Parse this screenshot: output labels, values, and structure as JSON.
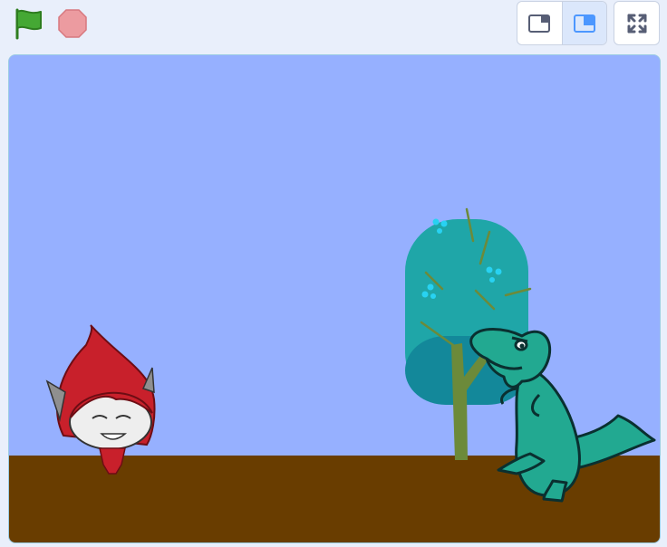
{
  "toolbar": {
    "green_flag_icon": "green-flag-icon",
    "stop_icon": "stop-sign-icon",
    "small_stage_icon": "small-stage-layout-icon",
    "large_stage_icon": "large-stage-layout-icon",
    "fullscreen_icon": "fullscreen-icon",
    "active_mode": "large-stage"
  },
  "stage": {
    "backdrop": {
      "sky_color": "#96b0ff",
      "ground_color": "#693d00"
    },
    "sprites": [
      {
        "name_icon": "red-hair-character-icon",
        "color": "#c8202b"
      },
      {
        "name_icon": "teal-tree-icon",
        "color": "#1fa6a8"
      },
      {
        "name_icon": "green-dinosaur-icon",
        "color": "#22a991"
      }
    ]
  },
  "colors": {
    "accent": "#4c97ff",
    "flag_green": "#45a834",
    "stop_red": "#ec9ba0"
  }
}
